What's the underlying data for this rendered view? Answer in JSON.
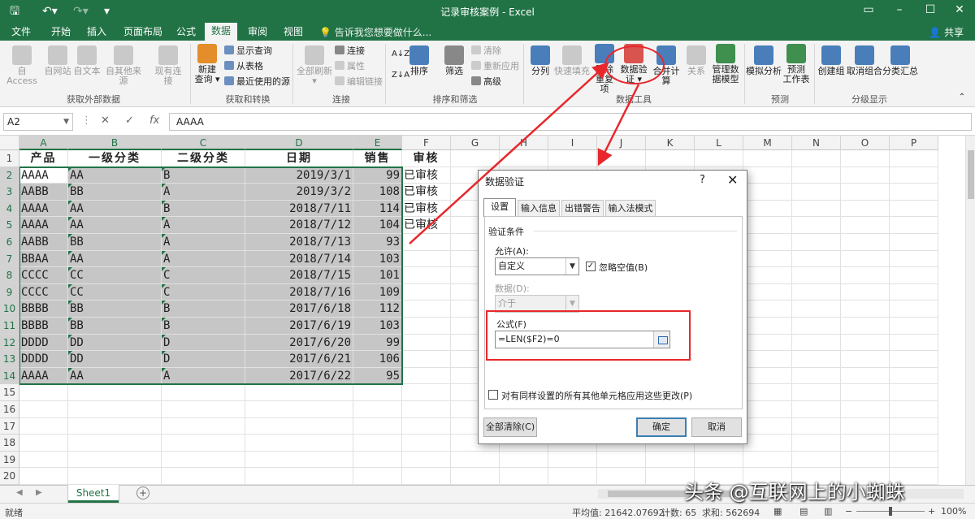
{
  "window": {
    "title": "记录审核案例 - Excel",
    "save_icon": "save-icon",
    "undo_icon": "undo-icon",
    "redo_icon": "redo-icon"
  },
  "ribbon_tabs": {
    "items": [
      "文件",
      "开始",
      "插入",
      "页面布局",
      "公式",
      "数据",
      "审阅",
      "视图"
    ],
    "active": "数据",
    "tell_me": "告诉我您想要做什么...",
    "share": "共享"
  },
  "ribbon": {
    "get_external": {
      "buttons": [
        "自 Access",
        "自网站",
        "自文本",
        "自其他来源",
        "现有连接"
      ],
      "label": "获取外部数据"
    },
    "get_transform": {
      "new_query_1": "新建",
      "new_query_2": "查询",
      "show_queries": "显示查询",
      "from_table": "从表格",
      "recent_sources": "最近使用的源",
      "label": "获取和转换"
    },
    "connections": {
      "refresh_all": "全部刷新",
      "connections": "连接",
      "properties": "属性",
      "edit_links": "编辑链接",
      "label": "连接"
    },
    "sort_filter": {
      "sort": "排序",
      "filter": "筛选",
      "clear": "清除",
      "reapply": "重新应用",
      "advanced": "高级",
      "label": "排序和筛选"
    },
    "data_tools": {
      "split": "分列",
      "flash_fill": "快速填充",
      "remove_dup_1": "删除",
      "remove_dup_2": "重复项",
      "validation_1": "数据验",
      "validation_2": "证",
      "consolidate": "合并计算",
      "relations": "关系",
      "manage_model_1": "管理数",
      "manage_model_2": "据模型",
      "label": "数据工具"
    },
    "forecast": {
      "what_if": "模拟分析",
      "sheet_1": "预测",
      "sheet_2": "工作表",
      "label": "预测"
    },
    "outline": {
      "group": "创建组",
      "ungroup": "取消组合",
      "subtotal": "分类汇总",
      "label": "分级显示"
    }
  },
  "formula_bar": {
    "name_box": "A2",
    "cancel": "✕",
    "enter": "✓",
    "fx": "fx",
    "value": "AAAA"
  },
  "grid": {
    "columns": [
      "A",
      "B",
      "C",
      "D",
      "E",
      "F",
      "G",
      "H",
      "I",
      "J",
      "K",
      "L",
      "M",
      "N",
      "O",
      "P"
    ],
    "rows": [
      "1",
      "2",
      "3",
      "4",
      "5",
      "6",
      "7",
      "8",
      "9",
      "10",
      "11",
      "12",
      "13",
      "14",
      "15",
      "16",
      "17",
      "18",
      "19",
      "20"
    ],
    "headers": [
      "产品",
      "一级分类",
      "二级分类",
      "日期",
      "销售",
      "审核"
    ],
    "data": [
      [
        "AAAA",
        "AA",
        "B",
        "2019/3/1",
        "99",
        "已审核"
      ],
      [
        "AABB",
        "BB",
        "A",
        "2019/3/2",
        "108",
        "已审核"
      ],
      [
        "AAAA",
        "AA",
        "B",
        "2018/7/11",
        "114",
        "已审核"
      ],
      [
        "AAAA",
        "AA",
        "A",
        "2018/7/12",
        "104",
        "已审核"
      ],
      [
        "AABB",
        "BB",
        "A",
        "2018/7/13",
        "93",
        ""
      ],
      [
        "BBAA",
        "AA",
        "A",
        "2018/7/14",
        "103",
        ""
      ],
      [
        "CCCC",
        "CC",
        "C",
        "2018/7/15",
        "101",
        ""
      ],
      [
        "CCCC",
        "CC",
        "C",
        "2018/7/16",
        "109",
        ""
      ],
      [
        "BBBB",
        "BB",
        "B",
        "2017/6/18",
        "112",
        ""
      ],
      [
        "BBBB",
        "BB",
        "B",
        "2017/6/19",
        "103",
        ""
      ],
      [
        "DDDD",
        "DD",
        "D",
        "2017/6/20",
        "99",
        ""
      ],
      [
        "DDDD",
        "DD",
        "D",
        "2017/6/21",
        "106",
        ""
      ],
      [
        "AAAA",
        "AA",
        "A",
        "2017/6/22",
        "95",
        ""
      ]
    ]
  },
  "sheets": {
    "tabs": [
      "Sheet1"
    ],
    "add": "⊕"
  },
  "status_bar": {
    "mode": "就绪",
    "average": "平均值: 21642.07692",
    "count": "计数: 65",
    "sum": "求和: 562694",
    "zoom": "100%",
    "zoom_minus": "−",
    "zoom_plus": "+"
  },
  "dialog": {
    "title": "数据验证",
    "help": "?",
    "close": "✕",
    "tabs": [
      "设置",
      "输入信息",
      "出错警告",
      "输入法模式"
    ],
    "section": "验证条件",
    "allow_label": "允许(A):",
    "allow_value": "自定义",
    "ignore_blank": "忽略空值(B)",
    "data_label": "数据(D):",
    "data_value": "介于",
    "formula_label": "公式(F)",
    "formula_value": "=LEN($F2)=0",
    "apply_all": "对有同样设置的所有其他单元格应用这些更改(P)",
    "clear_all": "全部清除(C)",
    "ok": "确定",
    "cancel": "取消"
  },
  "watermark": "头条 @互联网上的小蜘蛛",
  "colors": {
    "excel_green": "#217346",
    "annotation_red": "#e8272c"
  }
}
